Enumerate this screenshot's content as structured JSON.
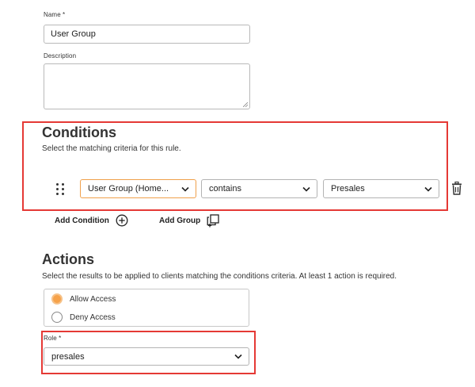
{
  "name_field": {
    "label": "Name *",
    "value": "User Group"
  },
  "description_field": {
    "label": "Description",
    "value": ""
  },
  "conditions": {
    "title": "Conditions",
    "subtitle": "Select the matching criteria for this rule.",
    "row": {
      "attribute": "User Group (Home...",
      "operator": "contains",
      "value": "Presales"
    },
    "add_condition": "Add Condition",
    "add_group": "Add Group"
  },
  "actions": {
    "title": "Actions",
    "subtitle": "Select the results to be applied to clients matching the conditions criteria. At least 1 action is required.",
    "options": [
      {
        "label": "Allow Access",
        "selected": true
      },
      {
        "label": "Deny Access",
        "selected": false
      }
    ],
    "role_label": "Role *",
    "role_value": "presales"
  },
  "colors": {
    "highlight": "#e53935",
    "radio_selected": "#f6a24a",
    "focus_border": "#f0a04b"
  }
}
